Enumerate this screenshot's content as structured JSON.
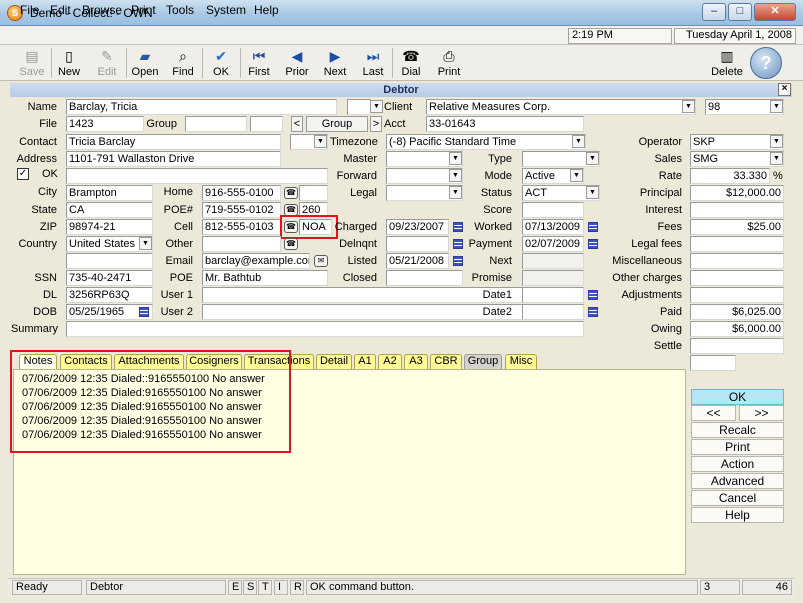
{
  "window": {
    "title": "Demo - Collect! - OWN",
    "minimize": "–",
    "maximize": "□",
    "close": "✕"
  },
  "menu": [
    "File",
    "Edit",
    "Browse",
    "Print",
    "Tools",
    "System",
    "Help"
  ],
  "clock": "2:19 PM",
  "date": "Tuesday April 1, 2008",
  "toolbar": {
    "save": "Save",
    "new": "New",
    "edit": "Edit",
    "open": "Open",
    "find": "Find",
    "ok": "OK",
    "first": "First",
    "prior": "Prior",
    "next": "Next",
    "last": "Last",
    "dial": "Dial",
    "print": "Print",
    "delete": "Delete"
  },
  "panel": {
    "title": "Debtor",
    "close": "×"
  },
  "labels": {
    "name": "Name",
    "file": "File",
    "group": "Group",
    "contact": "Contact",
    "address": "Address",
    "ok": "OK",
    "city": "City",
    "state": "State",
    "zip": "ZIP",
    "country": "Country",
    "home": "Home",
    "poe_num": "POE#",
    "cell": "Cell",
    "other": "Other",
    "email": "Email",
    "ssn": "SSN",
    "poe": "POE",
    "dl": "DL",
    "user1": "User 1",
    "dob": "DOB",
    "user2": "User 2",
    "summary": "Summary",
    "client": "Client",
    "acct": "Acct",
    "timezone": "Timezone",
    "master": "Master",
    "forward": "Forward",
    "legal": "Legal",
    "charged": "Charged",
    "delnqnt": "Delnqnt",
    "listed": "Listed",
    "closed": "Closed",
    "type": "Type",
    "mode": "Mode",
    "status": "Status",
    "score": "Score",
    "worked": "Worked",
    "payment": "Payment",
    "next": "Next",
    "promise": "Promise",
    "date1": "Date1",
    "date2": "Date2",
    "operator": "Operator",
    "sales": "Sales",
    "rate": "Rate",
    "principal": "Principal",
    "interest": "Interest",
    "fees": "Fees",
    "legal_fees": "Legal fees",
    "misc": "Miscellaneous",
    "other_charges": "Other charges",
    "adjustments": "Adjustments",
    "paid": "Paid",
    "owing": "Owing",
    "settle": "Settle"
  },
  "values": {
    "name": "Barclay, Tricia",
    "file": "1423",
    "group_btn": "Group",
    "prev": "<",
    "nextbtn": ">",
    "contact": "Tricia Barclay",
    "address": "1101-791 Wallaston Drive",
    "city": "Brampton",
    "state": "CA",
    "zip": "98974-21",
    "country": "United States",
    "home": "916-555-0100",
    "poe_num": "719-555-0102",
    "poe_ext": "260",
    "cell": "812-555-0103",
    "cell_tag": "NOA",
    "email": "barclay@example.com",
    "ssn": "735-40-2471",
    "poe": "Mr. Bathtub",
    "dl": "3256RP63Q",
    "dob": "05/25/1965",
    "client": "Relative Measures Corp.",
    "client_num": "98",
    "acct": "33-01643",
    "timezone": "(-8) Pacific Standard Time",
    "charged": "09/23/2007",
    "listed": "05/21/2008",
    "mode": "Active",
    "status": "ACT",
    "worked": "07/13/2009",
    "payment": "02/07/2009",
    "operator": "SKP",
    "sales": "SMG",
    "rate": "33.330",
    "rate_unit": "%",
    "principal": "$12,000.00",
    "fees": "$25.00",
    "paid": "$6,025.00",
    "owing": "$6,000.00"
  },
  "tabs": [
    "Notes",
    "Contacts",
    "Attachments",
    "Cosigners",
    "Transactions",
    "Detail",
    "A1",
    "A2",
    "A3",
    "CBR",
    "Group",
    "Misc"
  ],
  "notes": [
    "07/06/2009 12:35 Dialed::9165550100 No answer",
    "07/06/2009 12:35 Dialed:9165550100 No answer",
    "07/06/2009 12:35 Dialed:9165550100 No answer",
    "07/06/2009 12:35 Dialed:9165550100 No answer",
    "07/06/2009 12:35 Dialed:9165550100 No answer"
  ],
  "side_buttons": {
    "ok": "OK",
    "prev": "<<",
    "next": ">>",
    "recalc": "Recalc",
    "print": "Print",
    "action": "Action",
    "advanced": "Advanced",
    "cancel": "Cancel",
    "help": "Help"
  },
  "status": {
    "ready": "Ready",
    "screen": "Debtor",
    "e": "E",
    "s": "S",
    "t": "T",
    "i": "I",
    "r": "R",
    "msg": "OK command button.",
    "n1": "3",
    "n2": "46"
  }
}
